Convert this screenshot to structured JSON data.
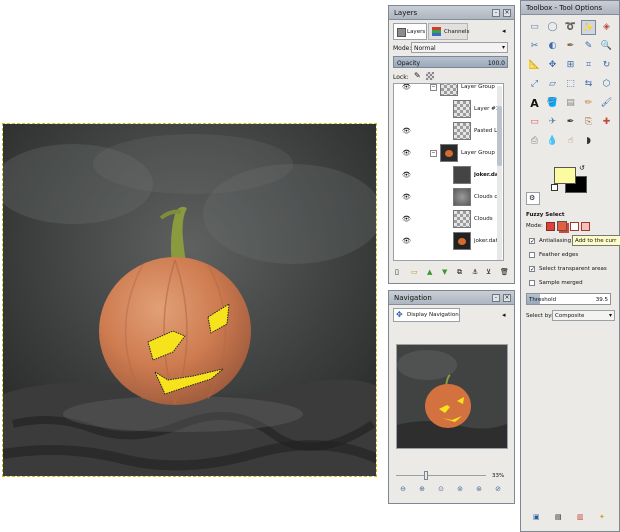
{
  "layers_panel": {
    "title": "Layers",
    "tabs": [
      "Layers",
      "Channels"
    ],
    "mode_label": "Mode:",
    "mode_value": "Normal",
    "opacity_label": "Opacity",
    "opacity_value": "100.0",
    "lock_label": "Lock:",
    "layers": [
      {
        "name": "Layer Group",
        "indent": 0,
        "expanded": true,
        "bold": false
      },
      {
        "name": "Layer #1",
        "indent": 1,
        "expanded": false,
        "bold": false
      },
      {
        "name": "Pasted La",
        "indent": 1,
        "expanded": false,
        "bold": false
      },
      {
        "name": "Layer Group",
        "indent": 0,
        "expanded": true,
        "bold": false
      },
      {
        "name": "joker.dat",
        "indent": 1,
        "expanded": false,
        "bold": true
      },
      {
        "name": "Clouds c",
        "indent": 1,
        "expanded": false,
        "bold": false
      },
      {
        "name": "Clouds",
        "indent": 1,
        "expanded": false,
        "bold": false
      },
      {
        "name": "joker.dat",
        "indent": 1,
        "expanded": false,
        "bold": false
      }
    ]
  },
  "navigation_panel": {
    "title": "Navigation",
    "tab_label": "Display Navigation",
    "zoom_value": "33%",
    "zoom_fraction": 0.33
  },
  "toolbox": {
    "title": "Toolbox - Tool Options",
    "tool_options_title": "Fuzzy Select",
    "mode_label": "Mode:",
    "tooltip": "Add to the curr",
    "options": [
      {
        "label": "Antialiasing",
        "checked": true
      },
      {
        "label": "Feather edges",
        "checked": false
      },
      {
        "label": "Select transparent areas",
        "checked": true
      },
      {
        "label": "Sample merged",
        "checked": false
      }
    ],
    "threshold_label": "Threshold",
    "threshold_value": "39.5",
    "select_by_label": "Select by:",
    "select_by_value": "Composite",
    "fg_color": "#fdfba0",
    "bg_color": "#000000"
  }
}
